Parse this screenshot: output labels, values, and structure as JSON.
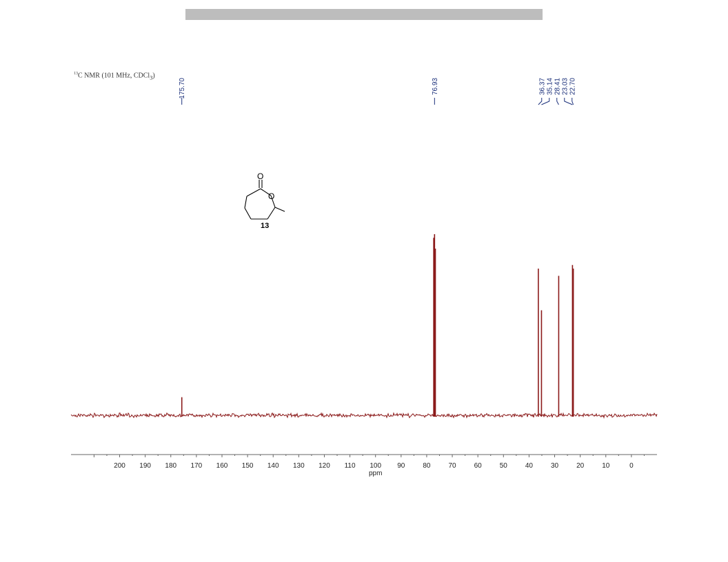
{
  "header": {
    "bar_color": "#bdbdbd"
  },
  "spectrum": {
    "title_sup": "13",
    "title_main": "C NMR (101 MHz, CDCl",
    "title_sub": "3",
    "title_end": ")"
  },
  "structure": {
    "compound_number": "13",
    "carbonyl_O": "O",
    "ring_O": "O"
  },
  "chart_data": {
    "type": "line",
    "title": "13C NMR (101 MHz, CDCl3)",
    "xlabel": "ppm",
    "ylabel": "",
    "xlim": [
      219,
      -10
    ],
    "x_ticks": [
      200,
      190,
      180,
      170,
      160,
      150,
      140,
      130,
      120,
      110,
      100,
      90,
      80,
      70,
      60,
      50,
      40,
      30,
      20,
      10,
      0
    ],
    "line_color": "#8b1a1a",
    "label_color": "#1a2f7a",
    "peak_labels": [
      "175.70",
      "76.93",
      "36.37",
      "35.14",
      "28.41",
      "23.03",
      "22.70"
    ],
    "peaks": [
      {
        "ppm": 175.7,
        "height": 0.1
      },
      {
        "ppm": 77.25,
        "height": 0.98
      },
      {
        "ppm": 76.93,
        "height": 1.0
      },
      {
        "ppm": 76.61,
        "height": 0.92
      },
      {
        "ppm": 36.37,
        "height": 0.81
      },
      {
        "ppm": 35.14,
        "height": 0.58
      },
      {
        "ppm": 28.41,
        "height": 0.77
      },
      {
        "ppm": 23.03,
        "height": 0.83
      },
      {
        "ppm": 22.7,
        "height": 0.81
      }
    ],
    "grid": false
  }
}
